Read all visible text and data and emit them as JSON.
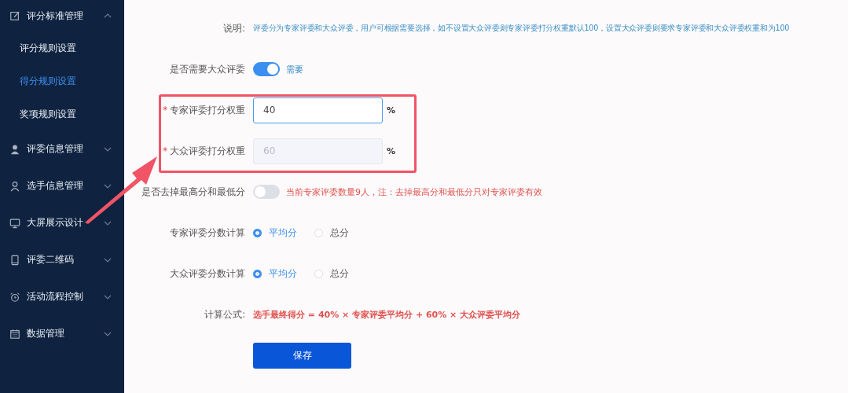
{
  "sidebar": {
    "items": [
      {
        "label": "评分标准管理",
        "expanded": true,
        "children": [
          {
            "label": "评分规则设置",
            "selected": false
          },
          {
            "label": "得分规则设置",
            "selected": true
          },
          {
            "label": "奖项规则设置",
            "selected": false
          }
        ]
      },
      {
        "label": "评委信息管理",
        "expanded": false
      },
      {
        "label": "选手信息管理",
        "expanded": false
      },
      {
        "label": "大屏展示设计",
        "expanded": false
      },
      {
        "label": "评委二维码",
        "expanded": false
      },
      {
        "label": "活动流程控制",
        "expanded": false
      },
      {
        "label": "数据管理",
        "expanded": false
      }
    ]
  },
  "form": {
    "rows": [
      {
        "kind": "note",
        "label": "说明:",
        "text": "评委分为专家评委和大众评委，用户可根据需要选择，如不设置大众评委则专家评委打分权重默认100，设置大众评委则要求专家评委和大众评委权重和为100"
      },
      {
        "kind": "switch",
        "label": "是否需要大众评委",
        "on": true,
        "text": "需要"
      },
      {
        "kind": "input",
        "label": "专家评委打分权重",
        "marker": "*",
        "value": "40",
        "focused": true,
        "disabled": false,
        "suffix": "%"
      },
      {
        "kind": "input",
        "label": "大众评委打分权重",
        "marker": "*",
        "value": "60",
        "focused": false,
        "disabled": true,
        "suffix": "%"
      },
      {
        "kind": "switch",
        "label": "是否去掉最高分和最低分",
        "on": false,
        "text": "当前专家评委数量9人，注：去掉最高分和最低分只对专家评委有效",
        "warn": true
      },
      {
        "kind": "radio",
        "label": "专家评委分数计算",
        "options": [
          {
            "label": "平均分",
            "selected": true
          },
          {
            "label": "总分",
            "selected": false
          }
        ]
      },
      {
        "kind": "radio",
        "label": "大众评委分数计算",
        "options": [
          {
            "label": "平均分",
            "selected": true
          },
          {
            "label": "总分",
            "selected": false
          }
        ]
      },
      {
        "kind": "formula",
        "label": "计算公式:",
        "text": "选手最终得分 = 40% × 专家评委平均分 + 60% × 大众评委平均分"
      },
      {
        "kind": "button",
        "label": "保存"
      }
    ]
  }
}
